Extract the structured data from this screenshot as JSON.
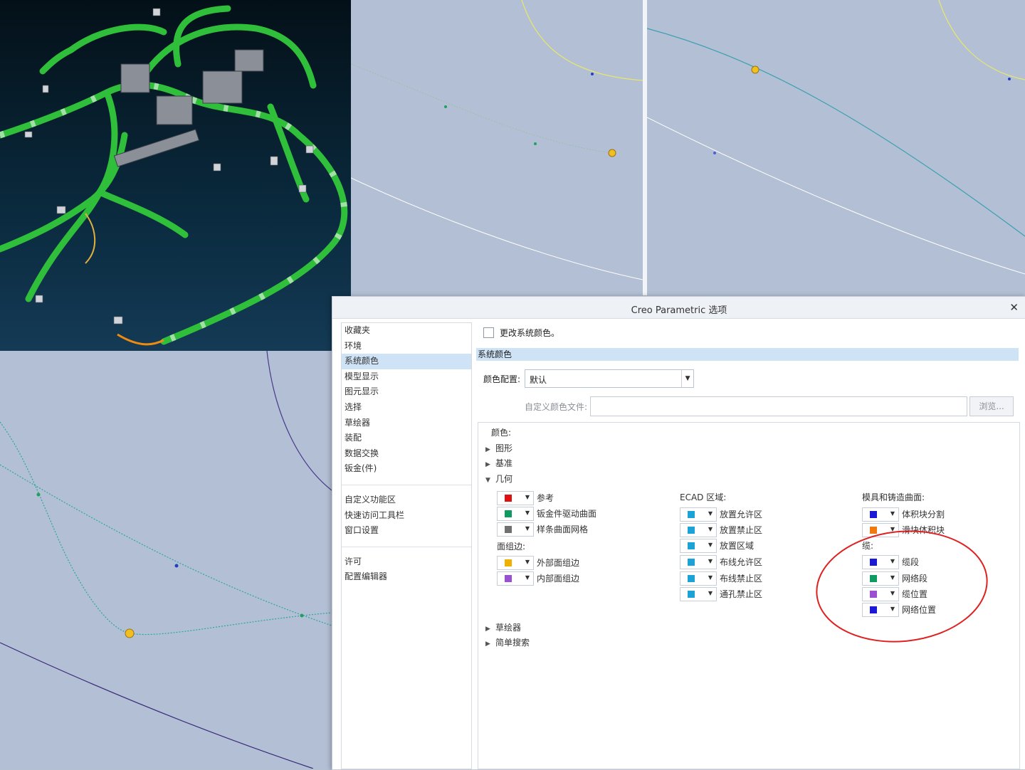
{
  "dialog": {
    "title": "Creo Parametric 选项",
    "close_glyph": "✕"
  },
  "nav": {
    "group1": [
      "收藏夹",
      "环境",
      "系统颜色",
      "模型显示",
      "图元显示",
      "选择",
      "草绘器",
      "装配",
      "数据交换",
      "钣金(件)"
    ],
    "group2": [
      "自定义功能区",
      "快速访问工具栏",
      "窗口设置"
    ],
    "group3": [
      "许可",
      "配置编辑器"
    ],
    "selected": "系统颜色"
  },
  "content": {
    "change_system_colors": "更改系统颜色。",
    "section_title": "系统颜色",
    "scheme_label": "颜色配置:",
    "scheme_value": "默认",
    "custom_file_label": "自定义颜色文件:",
    "browse_label": "浏览...",
    "colors_label": "颜色:",
    "tree": {
      "graphics": "图形",
      "datum": "基准",
      "geometry": "几何",
      "sketcher": "草绘器",
      "simple_search": "简单搜索"
    },
    "geometry_items": [
      {
        "label": "参考",
        "color": "#e01010"
      },
      {
        "label": "钣金件驱动曲面",
        "color": "#0f9a62"
      },
      {
        "label": "样条曲面网格",
        "color": "#707070"
      }
    ],
    "face_edge_label": "面组边:",
    "face_edge_items": [
      {
        "label": "外部面组边",
        "color": "#f0b000"
      },
      {
        "label": "内部面组边",
        "color": "#9b4fd1"
      }
    ],
    "ecad_label": "ECAD 区域:",
    "ecad_items": [
      {
        "label": "放置允许区",
        "color": "#1ba2d6"
      },
      {
        "label": "放置禁止区",
        "color": "#1ba2d6"
      },
      {
        "label": "放置区域",
        "color": "#1ba2d6"
      },
      {
        "label": "布线允许区",
        "color": "#1ba2d6"
      },
      {
        "label": "布线禁止区",
        "color": "#1ba2d6"
      },
      {
        "label": "通孔禁止区",
        "color": "#1ba2d6"
      }
    ],
    "mold_label": "模具和铸造曲面:",
    "mold_items": [
      {
        "label": "体积块分割",
        "color": "#1a1ad6"
      },
      {
        "label": "滑块体积块",
        "color": "#f07a10"
      }
    ],
    "cable_label": "缆:",
    "cable_items": [
      {
        "label": "缆段",
        "color": "#1a1ad6"
      },
      {
        "label": "网络段",
        "color": "#0f9a62"
      },
      {
        "label": "缆位置",
        "color": "#9b4fd1"
      },
      {
        "label": "网络位置",
        "color": "#1a1ad6"
      }
    ]
  },
  "colors": {
    "harness_green": "#2fbf3a",
    "viewport_bg": "#b3bfd4",
    "selection_blue": "#cfe3f7",
    "annotation_red": "#e02020"
  }
}
